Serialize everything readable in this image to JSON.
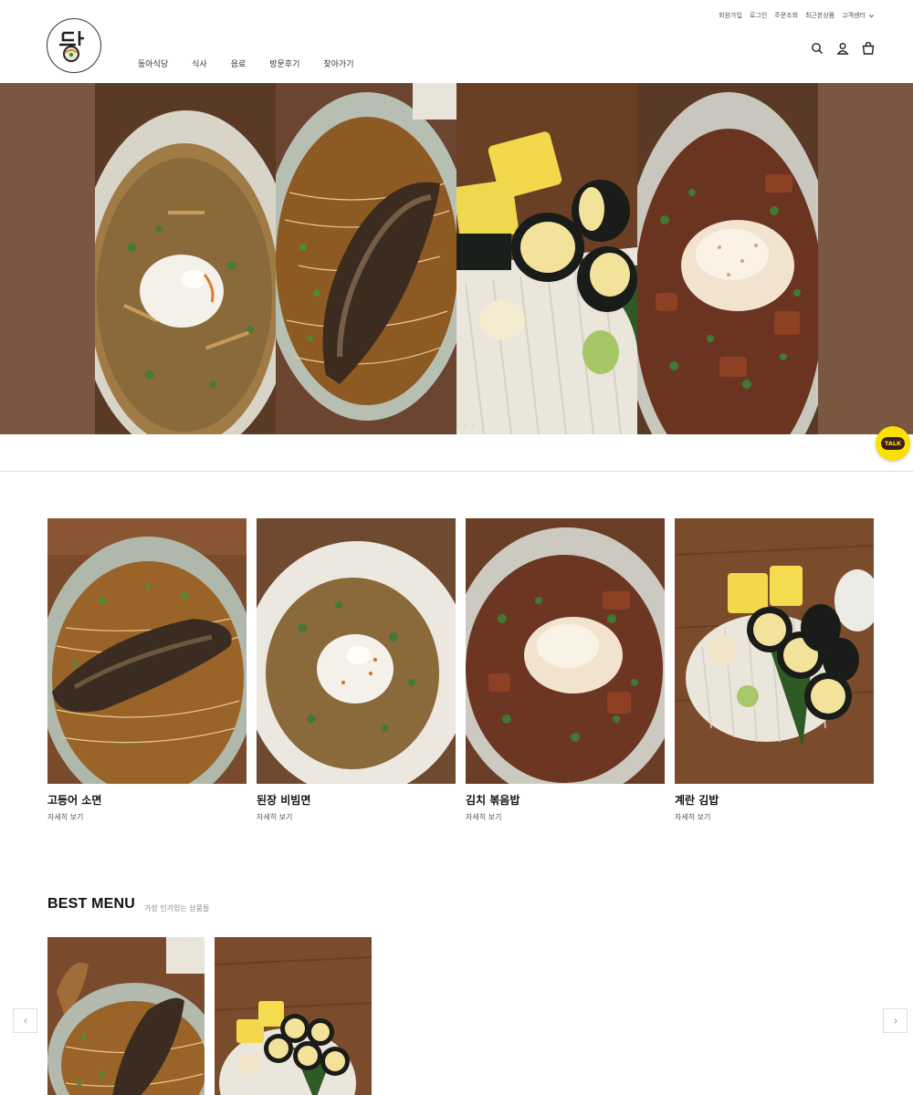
{
  "header": {
    "top_links": [
      "회원가입",
      "로그인",
      "주문조회",
      "최근본상품",
      "고객센터"
    ],
    "logo": {
      "icon": "bowl-logo-icon"
    },
    "nav": [
      "동아식당",
      "식사",
      "음료",
      "방문후기",
      "찾아가기"
    ],
    "utility_icons": [
      "search-icon",
      "user-icon",
      "cart-icon"
    ]
  },
  "hero": {
    "background": "#7a5740",
    "slides": [
      "bibim-noodle",
      "mackerel-somen",
      "egg-kimbap",
      "kimchi-fried-rice"
    ]
  },
  "kakao": {
    "label": "TALK",
    "color": "#fae100"
  },
  "menu_cards": [
    {
      "name": "고등어 소면",
      "more": "자세히 보기"
    },
    {
      "name": "된장 비빔면",
      "more": "자세히 보기"
    },
    {
      "name": "김치 볶음밥",
      "more": "자세히 보기"
    },
    {
      "name": "계란 김밥",
      "more": "자세히 보기"
    }
  ],
  "best": {
    "title": "BEST MENU",
    "subtitle": "가장 인기있는 상품들",
    "prev_icon": "chevron-left-icon",
    "next_icon": "chevron-right-icon"
  }
}
